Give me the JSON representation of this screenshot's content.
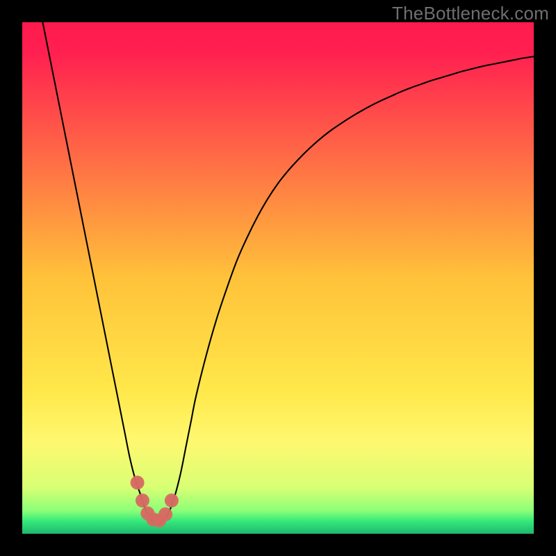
{
  "watermark": "TheBottleneck.com",
  "chart_data": {
    "type": "line",
    "title": "",
    "xlabel": "",
    "ylabel": "",
    "xlim": [
      0,
      100
    ],
    "ylim": [
      0,
      100
    ],
    "gradient_stops": [
      {
        "offset": 0.0,
        "color": "#ff1a4d"
      },
      {
        "offset": 0.06,
        "color": "#ff2050"
      },
      {
        "offset": 0.5,
        "color": "#ffc23a"
      },
      {
        "offset": 0.72,
        "color": "#ffe84a"
      },
      {
        "offset": 0.82,
        "color": "#fff870"
      },
      {
        "offset": 0.91,
        "color": "#d8ff74"
      },
      {
        "offset": 0.955,
        "color": "#8cff78"
      },
      {
        "offset": 0.975,
        "color": "#36e97a"
      },
      {
        "offset": 1.0,
        "color": "#1fb770"
      }
    ],
    "series": [
      {
        "name": "bottleneck-curve",
        "stroke": "#000000",
        "stroke_width": 2.1,
        "x": [
          4,
          5,
          6,
          7,
          8,
          9,
          10,
          11,
          12,
          13,
          14,
          15,
          16,
          17,
          18,
          19,
          20,
          21,
          22,
          23,
          24,
          25,
          26,
          27,
          28,
          29,
          30,
          31,
          32,
          33,
          34,
          36,
          38,
          40,
          42,
          44,
          46,
          48,
          50,
          52,
          54,
          56,
          58,
          60,
          62,
          64,
          66,
          68,
          70,
          72,
          74,
          76,
          78,
          80,
          82,
          84,
          86,
          88,
          90,
          92,
          94,
          96,
          98,
          100
        ],
        "y": [
          100,
          95,
          90,
          85,
          80,
          75,
          70,
          65,
          60,
          55,
          50,
          45,
          40,
          35,
          30,
          25,
          20,
          15,
          11,
          8,
          5,
          3,
          2,
          2,
          3,
          5,
          8,
          12,
          17,
          22,
          27,
          35,
          42,
          48,
          53.5,
          58,
          62,
          65.5,
          68.5,
          71,
          73.2,
          75.2,
          77,
          78.6,
          80,
          81.3,
          82.5,
          83.6,
          84.6,
          85.5,
          86.4,
          87.2,
          87.9,
          88.6,
          89.2,
          89.8,
          90.4,
          90.9,
          91.4,
          91.8,
          92.2,
          92.6,
          93,
          93.3
        ]
      }
    ],
    "markers": {
      "name": "valley-markers",
      "fill": "#d66a62",
      "fill_opacity": 0.95,
      "radius_outer": 10,
      "radius_inner": 6.5,
      "points": [
        {
          "x": 22.5,
          "y": 10
        },
        {
          "x": 23.5,
          "y": 6.5
        },
        {
          "x": 24.5,
          "y": 4
        },
        {
          "x": 25.6,
          "y": 2.8
        },
        {
          "x": 26.8,
          "y": 2.6
        },
        {
          "x": 28.0,
          "y": 3.8
        },
        {
          "x": 29.2,
          "y": 6.5
        }
      ]
    }
  }
}
